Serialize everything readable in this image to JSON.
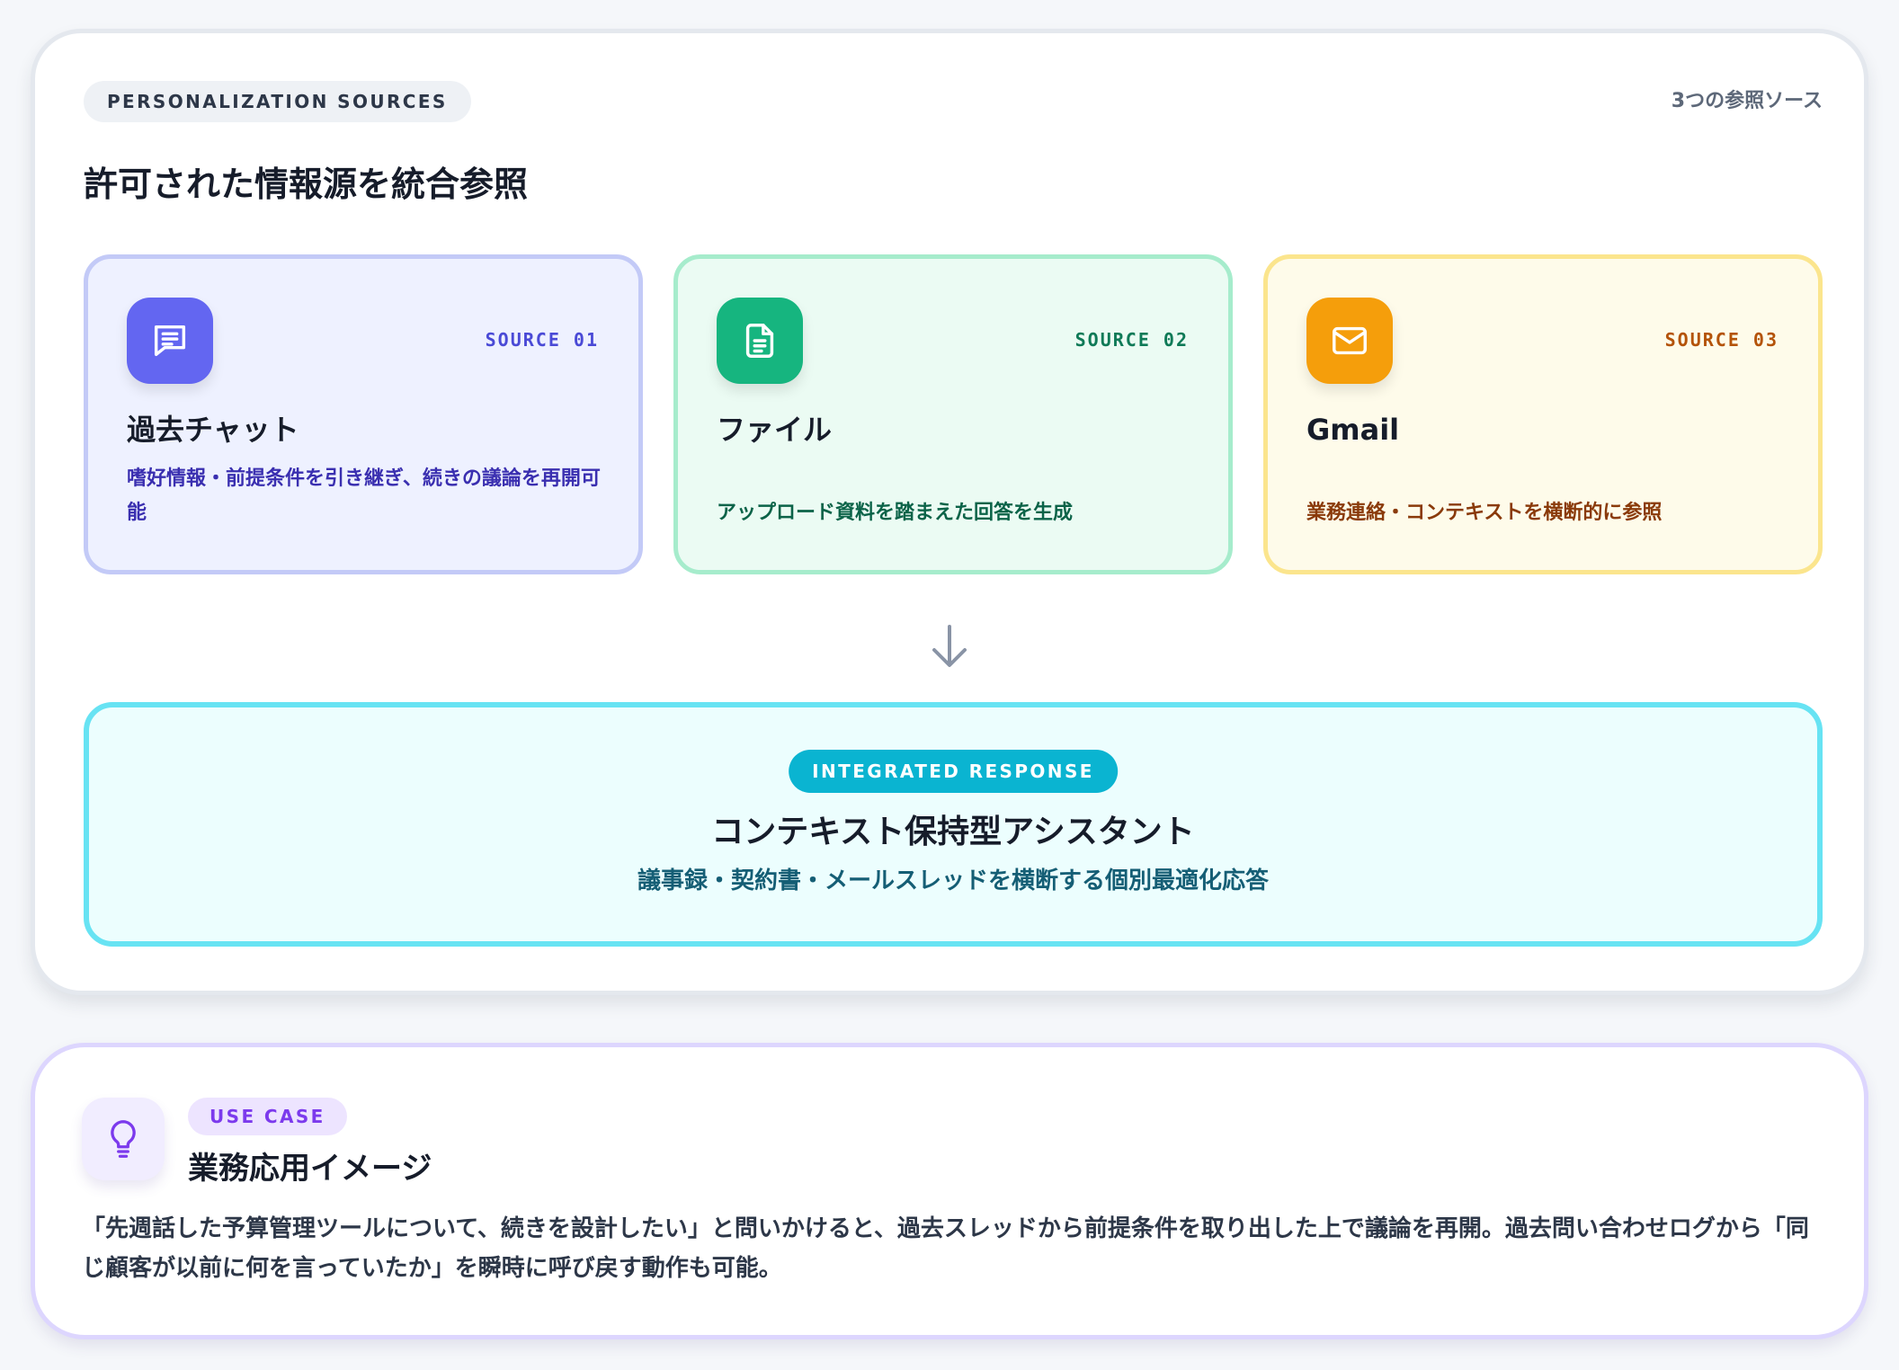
{
  "header": {
    "eyebrow": "PERSONALIZATION SOURCES",
    "source_count": "3つの参照ソース",
    "title": "許可された情報源を統合参照"
  },
  "sources": [
    {
      "tag": "SOURCE 01",
      "title": "過去チャット",
      "description": "嗜好情報・前提条件を引き継ぎ、続きの議論を再開可能",
      "icon": "chat-icon",
      "color": "#6366f1"
    },
    {
      "tag": "SOURCE 02",
      "title": "ファイル",
      "description": "アップロード資料を踏まえた回答を生成",
      "icon": "file-icon",
      "color": "#16b57f"
    },
    {
      "tag": "SOURCE 03",
      "title": "Gmail",
      "description": "業務連絡・コンテキストを横断的に参照",
      "icon": "mail-icon",
      "color": "#f59e0b"
    }
  ],
  "integrated": {
    "badge": "INTEGRATED RESPONSE",
    "title": "コンテキスト保持型アシスタント",
    "subtitle": "議事録・契約書・メールスレッドを横断する個別最適化応答",
    "accent": "#0ab4d1"
  },
  "usecase": {
    "badge": "USE CASE",
    "title": "業務応用イメージ",
    "body": "「先週話した予算管理ツールについて、続きを設計したい」と問いかけると、過去スレッドから前提条件を取り出した上で議論を再開。過去問い合わせログから「同じ顧客が以前に何を言っていたか」を瞬時に呼び戻す動作も可能。",
    "icon": "lightbulb-icon",
    "accent": "#7c3aed"
  }
}
